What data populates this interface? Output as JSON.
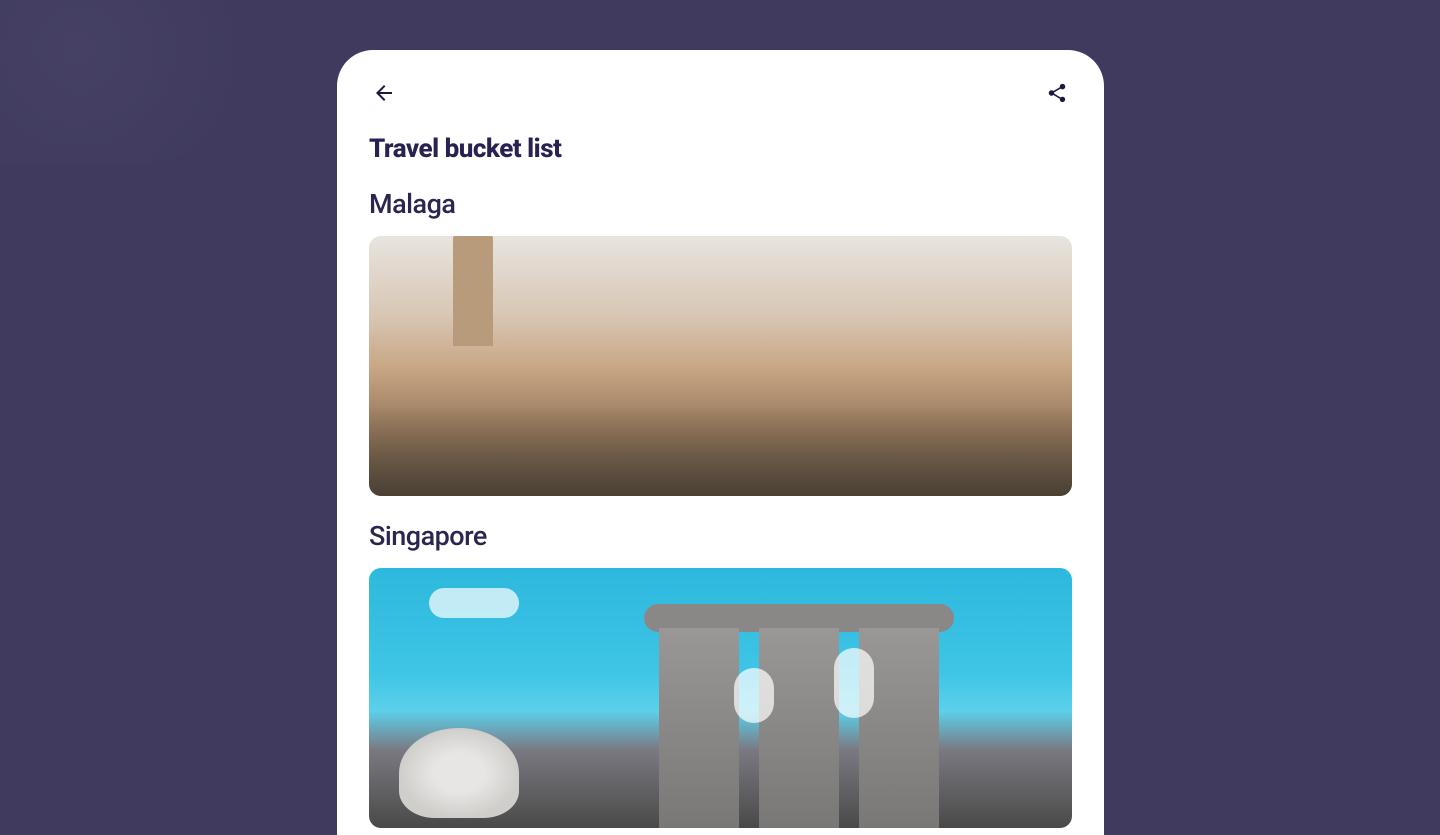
{
  "page": {
    "title": "Travel bucket list"
  },
  "items": [
    {
      "title": "Malaga",
      "image_name": "malaga-city-image"
    },
    {
      "title": "Singapore",
      "image_name": "singapore-marina-bay-image"
    }
  ]
}
